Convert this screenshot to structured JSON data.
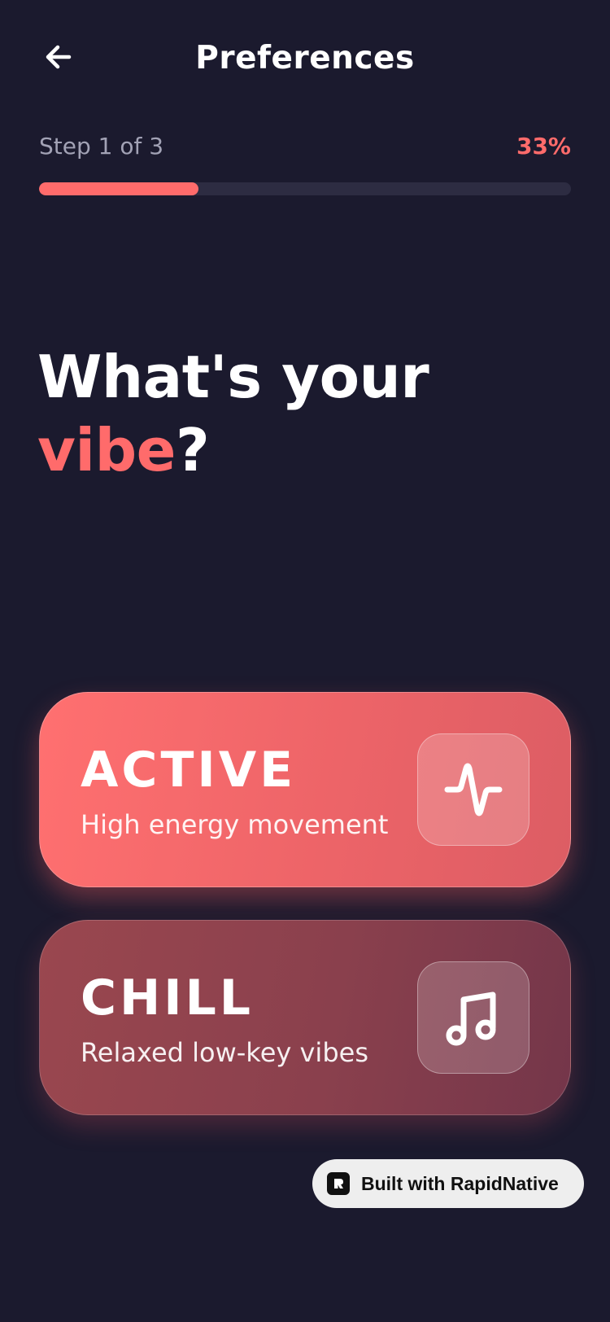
{
  "header": {
    "back_icon": "arrow-left-icon",
    "title": "Preferences"
  },
  "progress": {
    "step_label": "Step 1 of 3",
    "percent_label": "33%",
    "fraction": 0.3,
    "accent_color": "#ff6b6b"
  },
  "headline": {
    "line1": "What's your",
    "accent_word": "vibe",
    "punctuation": "?"
  },
  "options": [
    {
      "title": "ACTIVE",
      "subtitle": "High energy movement",
      "icon": "activity-pulse-icon"
    },
    {
      "title": "CHILL",
      "subtitle": "Relaxed low-key vibes",
      "icon": "music-note-icon"
    }
  ],
  "badge": {
    "label": "Built with RapidNative",
    "icon": "rapidnative-logo-icon"
  },
  "colors": {
    "background": "#1b1a2e",
    "accent": "#ff6b6b"
  }
}
